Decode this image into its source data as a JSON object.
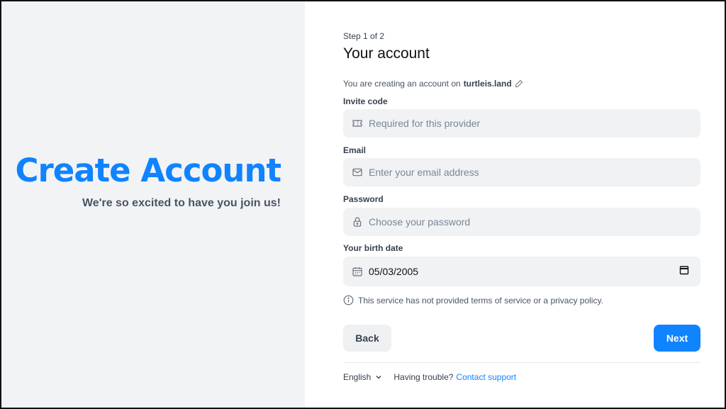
{
  "hero": {
    "title": "Create Account",
    "subtitle": "We're so excited to have you join us!"
  },
  "form": {
    "step": "Step 1 of 2",
    "title": "Your account",
    "provider_prefix": "You are creating an account on",
    "provider": "turtleis.land",
    "invite": {
      "label": "Invite code",
      "placeholder": "Required for this provider",
      "icon": "ticket-icon"
    },
    "email": {
      "label": "Email",
      "placeholder": "Enter your email address",
      "icon": "mail-icon"
    },
    "password": {
      "label": "Password",
      "placeholder": "Choose your password",
      "icon": "lock-icon"
    },
    "birth": {
      "label": "Your birth date",
      "value": "05/03/2005",
      "icon": "calendar-icon"
    },
    "notice": "This service has not provided terms of service or a privacy policy.",
    "back_label": "Back",
    "next_label": "Next"
  },
  "footer": {
    "language": "English",
    "trouble": "Having trouble?",
    "support": "Contact support"
  },
  "colors": {
    "accent": "#1083fe",
    "left_panel": "#f1f3f5",
    "field_bg": "#f0f2f4"
  }
}
